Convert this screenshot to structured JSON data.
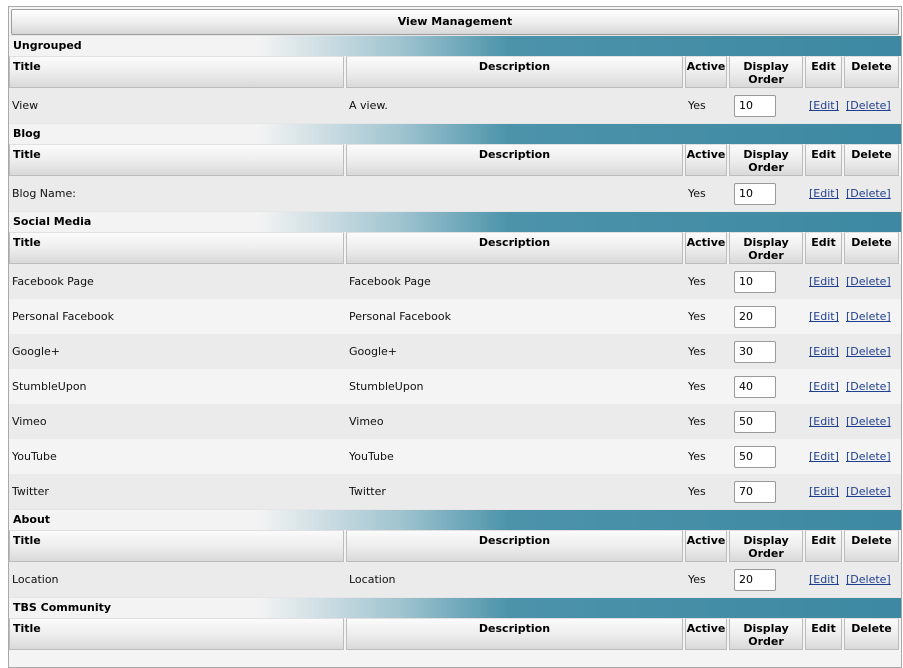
{
  "page": {
    "title": "View Management"
  },
  "columns": {
    "title": "Title",
    "description": "Description",
    "active": "Active",
    "display_order_line1": "Display",
    "display_order_line2": "Order",
    "edit": "Edit",
    "delete": "Delete"
  },
  "link_labels": {
    "edit": "[Edit]",
    "delete": "[Delete]"
  },
  "groups": [
    {
      "name": "Ungrouped",
      "rows": [
        {
          "title": "View",
          "description": "A view.",
          "active": "Yes",
          "order": "10"
        }
      ]
    },
    {
      "name": "Blog",
      "rows": [
        {
          "title": "Blog Name:",
          "description": "",
          "active": "Yes",
          "order": "10"
        }
      ]
    },
    {
      "name": "Social Media",
      "rows": [
        {
          "title": "Facebook Page",
          "description": "Facebook Page",
          "active": "Yes",
          "order": "10"
        },
        {
          "title": "Personal Facebook",
          "description": "Personal Facebook",
          "active": "Yes",
          "order": "20"
        },
        {
          "title": "Google+",
          "description": "Google+",
          "active": "Yes",
          "order": "30"
        },
        {
          "title": "StumbleUpon",
          "description": "StumbleUpon",
          "active": "Yes",
          "order": "40"
        },
        {
          "title": "Vimeo",
          "description": "Vimeo",
          "active": "Yes",
          "order": "50"
        },
        {
          "title": "YouTube",
          "description": "YouTube",
          "active": "Yes",
          "order": "50"
        },
        {
          "title": "Twitter",
          "description": "Twitter",
          "active": "Yes",
          "order": "70"
        }
      ]
    },
    {
      "name": "About",
      "rows": [
        {
          "title": "Location",
          "description": "Location",
          "active": "Yes",
          "order": "20"
        }
      ]
    },
    {
      "name": "TBS Community",
      "rows": []
    }
  ]
}
